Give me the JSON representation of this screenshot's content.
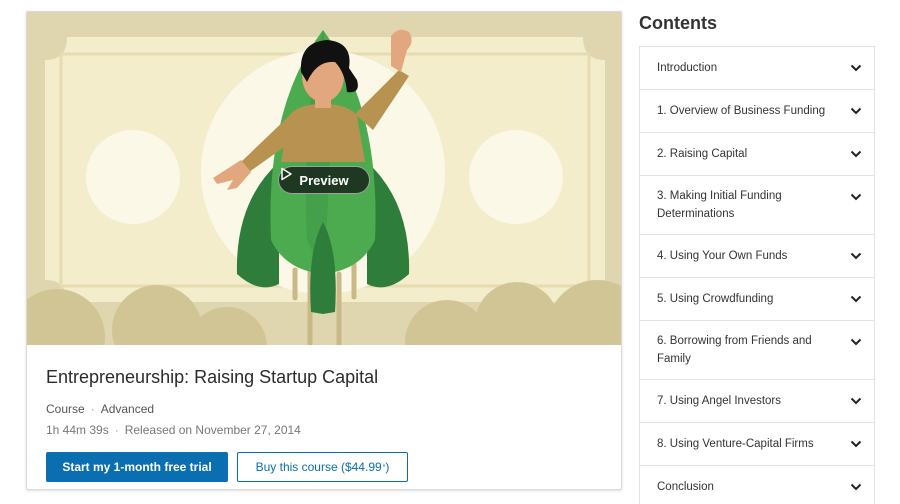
{
  "hero": {
    "preview_label": "Preview",
    "colors": {
      "background": "#dfd5ae",
      "bill": "#f3edcc",
      "rocket_light": "#4caa4f",
      "rocket_dark": "#2f7d3b",
      "skin": "#e3a77f",
      "shirt": "#b89250",
      "hair": "#111111"
    }
  },
  "course": {
    "title": "Entrepreneurship: Raising Startup Capital",
    "type": "Course",
    "level": "Advanced",
    "duration": "1h 44m 39s",
    "released": "Released on November 27, 2014",
    "trial_button": "Start my 1-month free trial",
    "buy_button": "Buy this course ($44.99",
    "buy_button_mark": "*",
    "buy_button_close": ")",
    "accent_color": "#0a6eb0"
  },
  "contents": {
    "title": "Contents",
    "items": [
      {
        "label": "Introduction"
      },
      {
        "label": "1. Overview of Business Funding"
      },
      {
        "label": "2. Raising Capital"
      },
      {
        "label": "3. Making Initial Funding Determinations"
      },
      {
        "label": "4. Using Your Own Funds"
      },
      {
        "label": "5. Using Crowdfunding"
      },
      {
        "label": "6. Borrowing from Friends and Family"
      },
      {
        "label": "7. Using Angel Investors"
      },
      {
        "label": "8. Using Venture-Capital Firms"
      },
      {
        "label": "Conclusion"
      }
    ]
  }
}
